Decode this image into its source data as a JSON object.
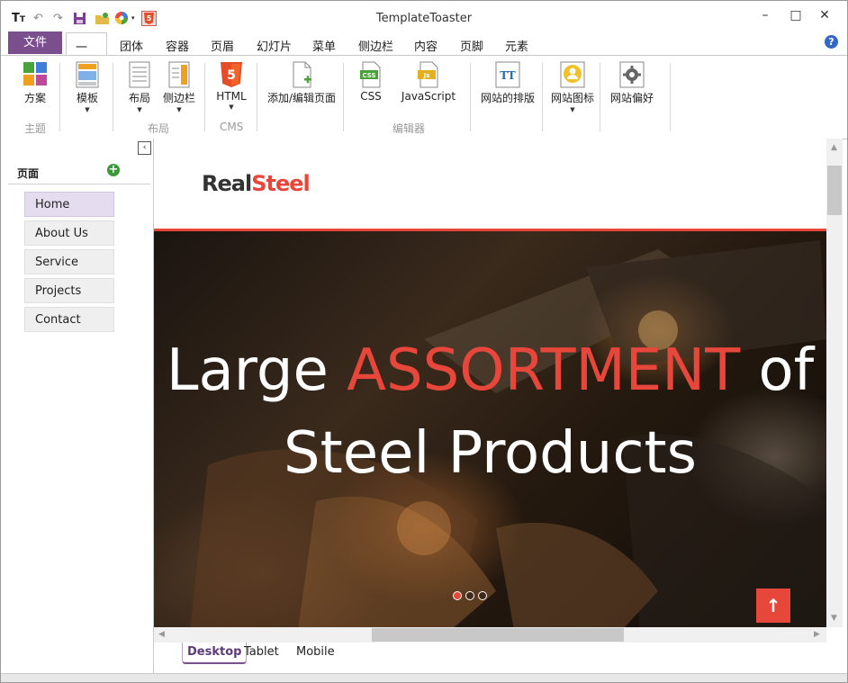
{
  "window": {
    "title": "TemplateToaster",
    "controls": [
      "minimize-icon",
      "maximize-icon",
      "close-icon"
    ]
  },
  "quick_access": [
    "text-style-icon",
    "undo-icon",
    "redo-icon",
    "save-icon",
    "open-folder-icon",
    "color-wheel-icon",
    "html5-icon"
  ],
  "menu": {
    "file": "文件",
    "tabs": [
      "一般",
      "团体",
      "容器",
      "页眉",
      "幻灯片",
      "菜单",
      "侧边栏",
      "内容",
      "页脚",
      "元素"
    ],
    "active_tab": "一般",
    "help_icon": "?"
  },
  "ribbon": {
    "buttons": {
      "scheme": "方案",
      "template": "模板",
      "layout": "布局",
      "sidebar": "侧边栏",
      "html": "HTML",
      "add_edit_page": "添加/编辑页面",
      "css": "CSS",
      "javascript": "JavaScript",
      "typography": "网站的排版",
      "site_icon": "网站图标",
      "preferences": "网站偏好"
    },
    "groups": {
      "theme": "主题",
      "layout": "布局",
      "cms": "CMS",
      "editor": "编辑器"
    },
    "icon_text": {
      "html5": "5",
      "css": "CSS",
      "js": "Js",
      "typography": "TT"
    }
  },
  "sidebar": {
    "collapse_icon": "‹",
    "heading": "页面",
    "add_icon": "+",
    "pages": [
      "Home",
      "About Us",
      "Service",
      "Projects",
      "Contact"
    ],
    "selected": "Home"
  },
  "preview": {
    "logo_part1": "Real",
    "logo_part2": "Steel",
    "hero_line1_a": "Large ",
    "hero_line1_b": "ASSORTMENT",
    "hero_line1_c": " of",
    "hero_line2": "Steel Products",
    "slider_dots": 3,
    "active_dot": 1,
    "scroll_top_icon": "↑"
  },
  "view_tabs": [
    "Desktop",
    "Tablet",
    "Mobile"
  ],
  "active_view": "Desktop",
  "colors": {
    "accent": "#7b4f8e",
    "brand_red": "#e7473a",
    "selected_page": "#e6dcf0"
  }
}
